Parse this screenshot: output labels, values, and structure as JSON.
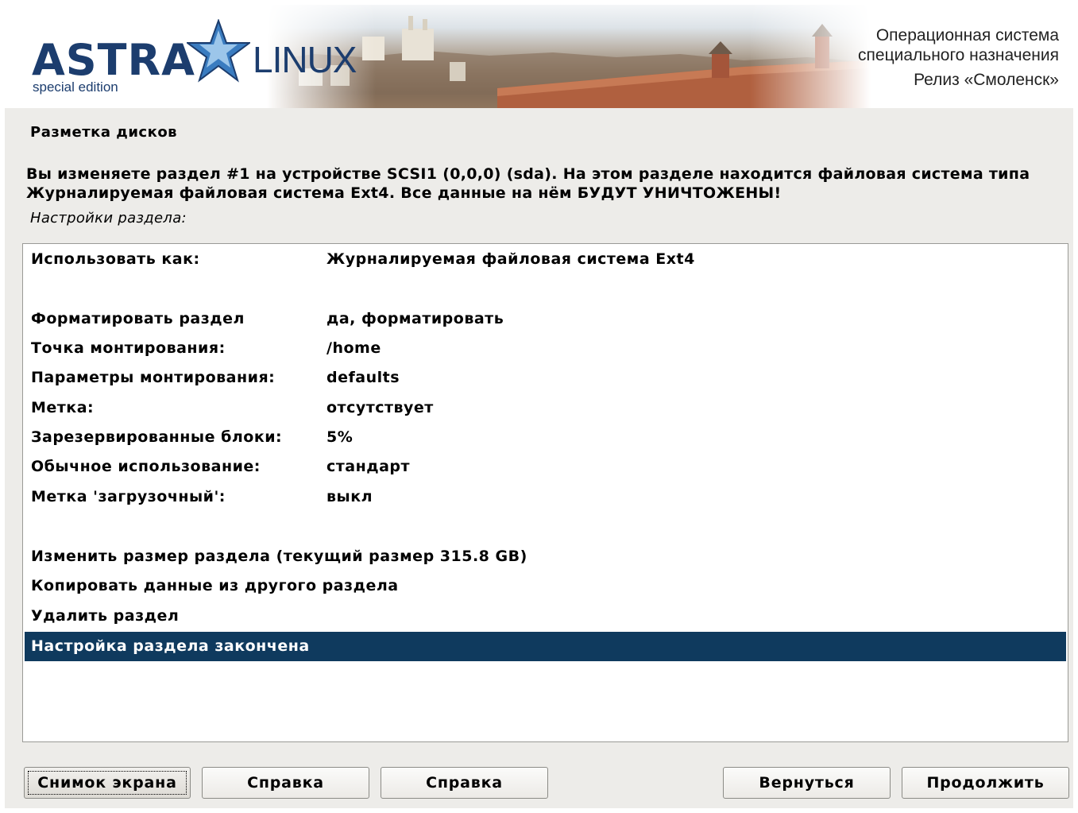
{
  "banner": {
    "logo_main": "ASTRA",
    "logo_secondary": "LINUX",
    "logo_edition": "special edition",
    "tagline_line1": "Операционная система",
    "tagline_line2": "специального назначения",
    "tagline_line3": "Релиз «Смоленск»"
  },
  "page_title": "Разметка дисков",
  "description": "Вы изменяете раздел #1 на устройстве SCSI1 (0,0,0) (sda). На этом разделе находится файловая система типа Журналируемая файловая система Ext4. Все данные на нём БУДУТ УНИЧТОЖЕНЫ!",
  "subtitle": "Настройки раздела:",
  "settings": [
    {
      "key": "Использовать как:",
      "value": "Журналируемая файловая система Ext4"
    },
    {
      "key": "Форматировать раздел",
      "value": "да, форматировать"
    },
    {
      "key": "Точка монтирования:",
      "value": "/home"
    },
    {
      "key": "Параметры монтирования:",
      "value": "defaults"
    },
    {
      "key": "Метка:",
      "value": "отсутствует"
    },
    {
      "key": "Зарезервированные блоки:",
      "value": "5%"
    },
    {
      "key": "Обычное использование:",
      "value": "стандарт"
    },
    {
      "key": "Метка 'загрузочный':",
      "value": "выкл"
    }
  ],
  "actions": [
    "Изменить размер раздела (текущий размер 315.8 GB)",
    "Копировать данные из другого раздела",
    "Удалить раздел",
    "Настройка раздела закончена"
  ],
  "selected_action_index": 3,
  "buttons": {
    "screenshot": "Снимок экрана",
    "help1": "Справка",
    "help2": "Справка",
    "back": "Вернуться",
    "continue": "Продолжить"
  },
  "colors": {
    "selection_bg": "#0f3a5e",
    "logo_blue": "#1c3d6e",
    "panel_bg": "#edece9"
  }
}
